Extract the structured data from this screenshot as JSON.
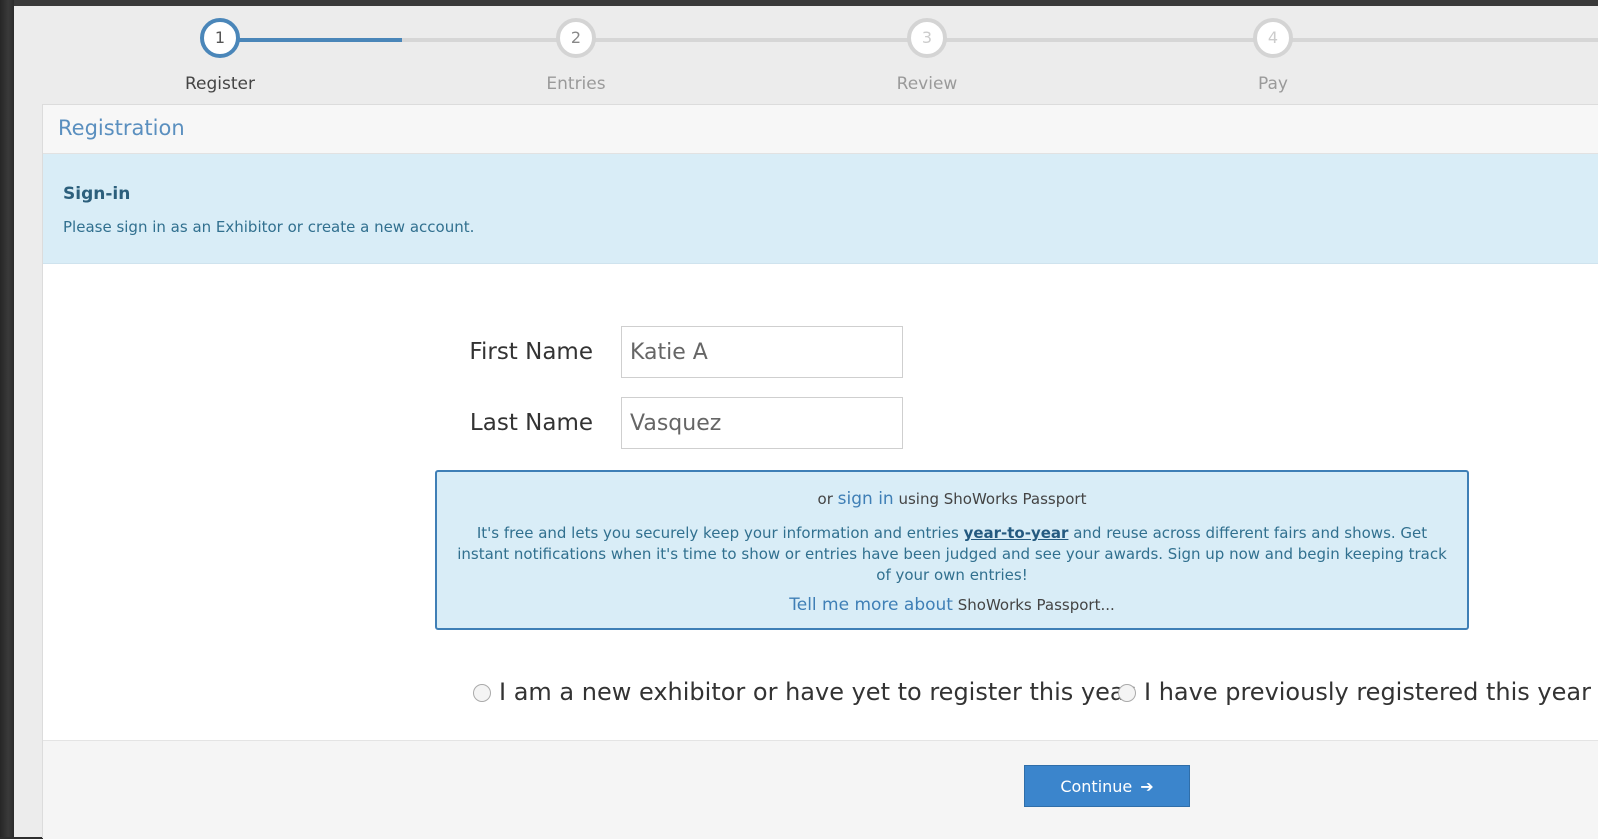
{
  "steps": [
    {
      "number": "1",
      "label": "Register"
    },
    {
      "number": "2",
      "label": "Entries"
    },
    {
      "number": "3",
      "label": "Review"
    },
    {
      "number": "4",
      "label": "Pay"
    }
  ],
  "panel": {
    "title": "Registration"
  },
  "alert": {
    "title": "Sign-in",
    "text": "Please sign in as an Exhibitor or create a new account."
  },
  "form": {
    "first_name_label": "First Name",
    "first_name_value": "Katie A",
    "last_name_label": "Last Name",
    "last_name_value": "Vasquez"
  },
  "passport": {
    "or": "or",
    "sign_in_link": "sign in",
    "using": "using ShoWorks Passport",
    "body_start": "It's free and lets you securely keep your information and entries",
    "body_emphasis": "year-to-year",
    "body_end": "and reuse across different fairs and shows. Get instant notifications when it's time to show or entries have been judged and see your awards. Sign up now and begin keeping track of your own entries!",
    "more_link": "Tell me more about",
    "more_suffix": "ShoWorks Passport..."
  },
  "options": {
    "new_exhibitor": "I am a new exhibitor or have yet to register this year",
    "previously_registered": "I have previously registered this year"
  },
  "footer": {
    "continue_label": "Continue"
  },
  "colors": {
    "accent": "#4a86b9",
    "button": "#3b85cc",
    "alert_bg": "#d9edf7"
  }
}
